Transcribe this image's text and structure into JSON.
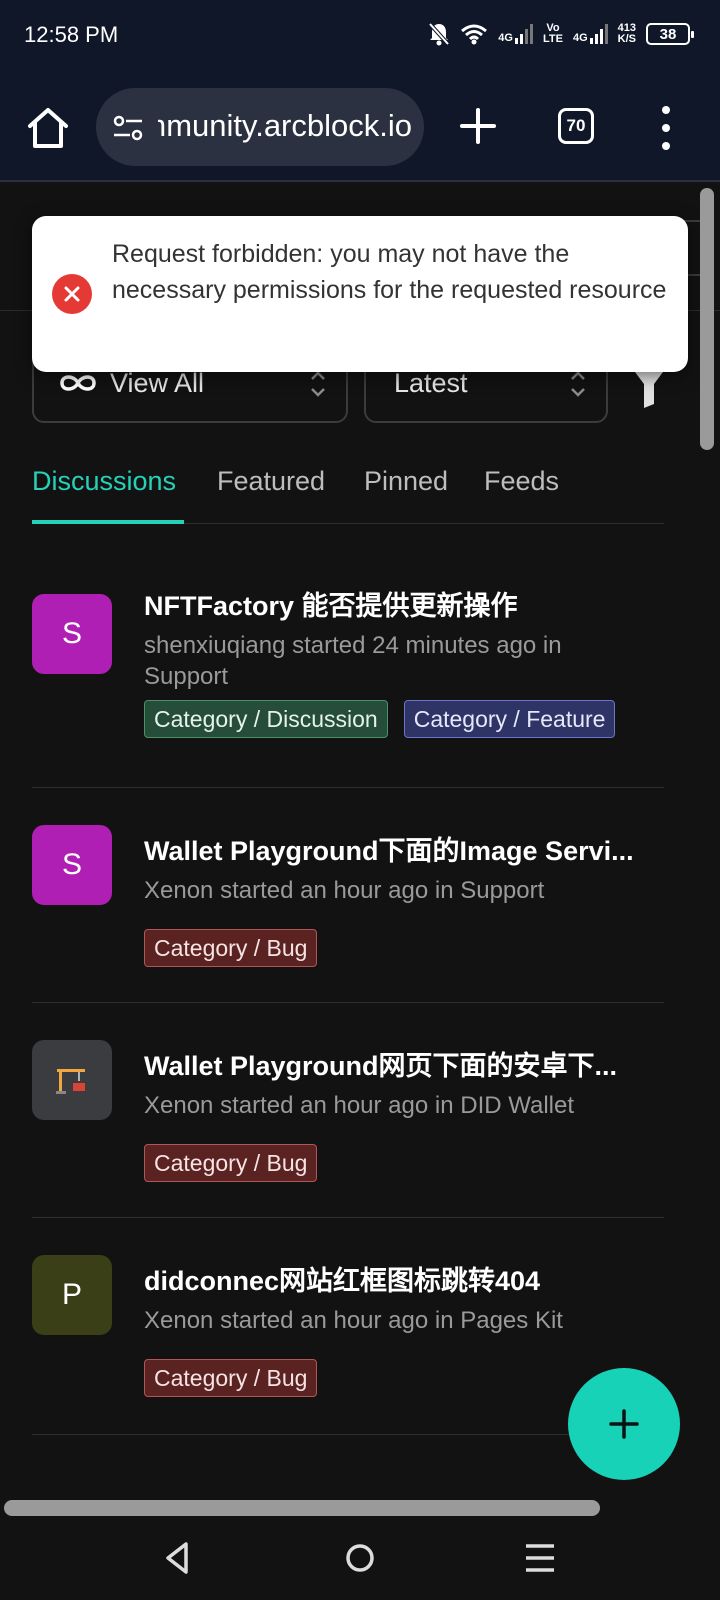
{
  "status_bar": {
    "time": "12:58 PM",
    "network_1": "4G",
    "volte_top": "Vo",
    "volte_bottom": "LTE",
    "network_2": "4G",
    "speed_value": "413",
    "speed_unit": "K/S",
    "battery": "38"
  },
  "browser": {
    "url": "community.arcblock.io",
    "tab_count": "70"
  },
  "filters": {
    "view": "View All",
    "sort": "Latest"
  },
  "tabs": [
    {
      "label": "Discussions",
      "active": true
    },
    {
      "label": "Featured",
      "active": false
    },
    {
      "label": "Pinned",
      "active": false
    },
    {
      "label": "Feeds",
      "active": false
    }
  ],
  "posts": [
    {
      "avatar": "S",
      "avatar_color": "#b01fb3",
      "title": "NFTFactory 能否提供更新操作",
      "meta": "shenxiuqiang started 24 minutes ago in Support",
      "tags": [
        "Category / Discussion",
        "Category / Feature"
      ]
    },
    {
      "avatar": "S",
      "avatar_color": "#b01fb3",
      "title": "Wallet Playground下面的Image Servi...",
      "meta": "Xenon started an hour ago in Support",
      "tags": [
        "Category / Bug"
      ]
    },
    {
      "avatar": "",
      "avatar_color": "#3b3c40",
      "title": "Wallet Playground网页下面的安卓下...",
      "meta": "Xenon started an hour ago in DID Wallet",
      "tags": [
        "Category / Bug"
      ]
    },
    {
      "avatar": "P",
      "avatar_color": "#3a3f17",
      "title": "didconnec网站红框图标跳转404",
      "meta": "Xenon started an hour ago in Pages Kit",
      "tags": [
        "Category / Bug"
      ]
    }
  ],
  "toast": {
    "message": "Request forbidden: you may not have the necessary permissions for the requested resource"
  },
  "colors": {
    "accent": "#26d1b8",
    "fab": "#17d2b7",
    "error": "#e53935"
  },
  "icons": [
    "home-icon",
    "site-settings-icon",
    "plus-icon",
    "more-vert-icon",
    "infinity-icon",
    "chevron-updown-icon",
    "error-icon",
    "crane-icon",
    "back-nav-icon",
    "home-nav-icon",
    "recents-nav-icon"
  ]
}
